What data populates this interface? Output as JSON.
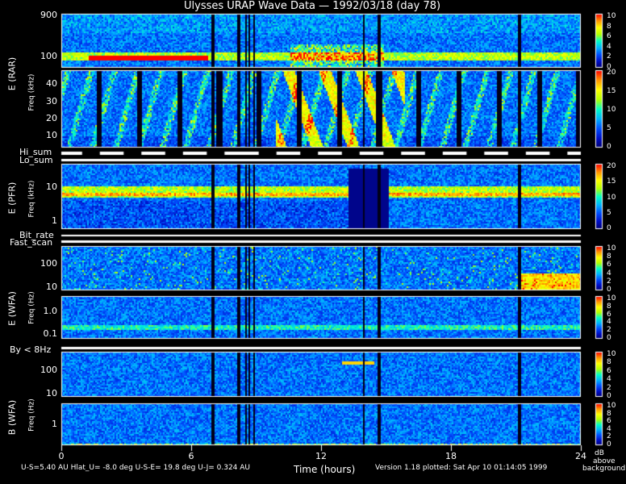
{
  "chart_data": {
    "type": "heatmap",
    "title": "Ulysses URAP Wave Data — 1992/03/18  (day 78)",
    "xlabel": "Time (hours)",
    "xlim": [
      0,
      24
    ],
    "xticks": [
      "0",
      "6",
      "12",
      "18",
      "24"
    ],
    "panels": [
      {
        "id": "rar_high",
        "ylabel": "E (RAR)",
        "unit": "Freq (kHz)",
        "yticks": [
          "900",
          "100"
        ],
        "colorbar_ticks": [
          "10",
          "8",
          "6",
          "4",
          "2",
          "0"
        ],
        "colorbar_max": 10
      },
      {
        "id": "rar_low",
        "ylabel": "",
        "unit": "",
        "yticks": [
          "40",
          "30",
          "20",
          "10"
        ],
        "colorbar_ticks": [
          "20",
          "15",
          "10",
          "5",
          "0"
        ],
        "colorbar_max": 20
      },
      {
        "id": "pfr",
        "ylabel": "E (PFR)",
        "unit": "Freq (kHz)",
        "yticks": [
          "10",
          "1"
        ],
        "colorbar_ticks": [
          "20",
          "15",
          "10",
          "5",
          "0"
        ],
        "colorbar_max": 20
      },
      {
        "id": "wfa_e_high",
        "ylabel": "E (WFA)",
        "unit": "Freq (Hz)",
        "yticks": [
          "100",
          "10"
        ],
        "colorbar_ticks": [
          "10",
          "8",
          "6",
          "4",
          "2",
          "0"
        ],
        "colorbar_max": 10
      },
      {
        "id": "wfa_e_low",
        "ylabel": "",
        "unit": "",
        "yticks": [
          "1.0",
          "0.1"
        ],
        "colorbar_ticks": [
          "10",
          "8",
          "6",
          "4",
          "2",
          "0"
        ],
        "colorbar_max": 10
      },
      {
        "id": "wfa_b_high",
        "ylabel": "",
        "unit": "",
        "yticks": [
          "100",
          "10"
        ],
        "colorbar_ticks": [
          "10",
          "8",
          "6",
          "4",
          "2",
          "0"
        ],
        "colorbar_max": 10
      },
      {
        "id": "wfa_b_low",
        "ylabel": "B (WFA)",
        "unit": "Freq (Hz)",
        "yticks": [
          "1"
        ],
        "colorbar_ticks": [
          "10",
          "8",
          "6",
          "4",
          "2",
          "0"
        ],
        "colorbar_max": 10
      }
    ],
    "mode_strips": [
      "Hi_sum",
      "Lo_sum",
      "Bit_rate",
      "Fast_scan",
      "By < 8Hz"
    ],
    "colorbar_unit": [
      "dB",
      "above",
      "background"
    ],
    "footer": {
      "left": "U-S=5.40 AU  Hlat_U= -8.0 deg  U-S-E= 19.8 deg  U-J= 0.324 AU",
      "right": "Version 1.18 plotted: Sat Apr 10 01:14:05 1999"
    },
    "colormap": [
      "#00006e",
      "#0010c8",
      "#0050ff",
      "#00b4ff",
      "#00ffc8",
      "#b4ff00",
      "#ffff00",
      "#ff9600",
      "#ff0000"
    ]
  }
}
